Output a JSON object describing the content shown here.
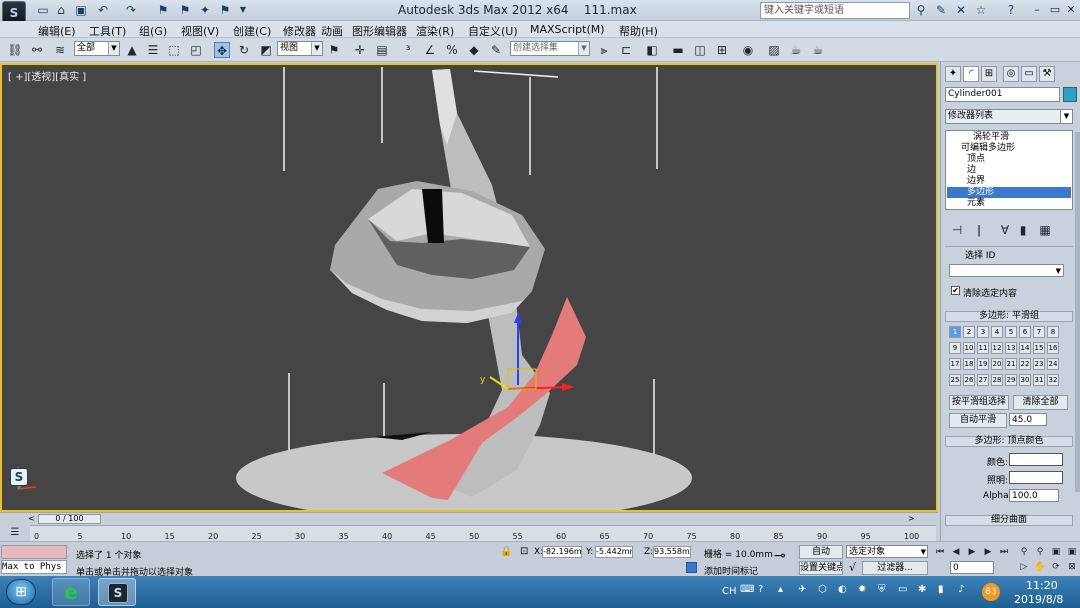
{
  "titlebar": {
    "app": "Autodesk 3ds Max  2012 x64",
    "file": "111.max",
    "search_placeholder": "键入关键字或短语"
  },
  "menu": [
    "编辑(E)",
    "工具(T)",
    "组(G)",
    "视图(V)",
    "创建(C)",
    "修改器",
    "动画",
    "图形编辑器",
    "渲染(R)",
    "自定义(U)",
    "MAXScript(M)",
    "帮助(H)"
  ],
  "toolbar": {
    "filter_value": "全部",
    "refcoord_value": "视图",
    "selection_set_value": "创建选择集"
  },
  "viewport": {
    "label": "[ +][透视][真实 ]"
  },
  "command_panel": {
    "object_name": "Cylinder001",
    "object_color": "#2aa3c8",
    "modifier_list": "修改器列表",
    "stack": [
      "涡轮平滑",
      "可编辑多边形",
      "顶点",
      "边",
      "边界",
      "多边形",
      "元素"
    ],
    "selected_stack_item": "多边形",
    "select_id_label": "选择 ID",
    "clear_selection_label": "清除选定内容",
    "smoothing_title": "多边形: 平滑组",
    "smoothing_groups": [
      "1",
      "2",
      "3",
      "4",
      "5",
      "6",
      "7",
      "8",
      "9",
      "10",
      "11",
      "12",
      "13",
      "14",
      "15",
      "16",
      "17",
      "18",
      "19",
      "20",
      "21",
      "22",
      "23",
      "24",
      "25",
      "26",
      "27",
      "28",
      "29",
      "30",
      "31",
      "32"
    ],
    "active_group": "1",
    "select_by_sg": "按平滑组选择",
    "clear_all": "清除全部",
    "auto_smooth": "自动平滑",
    "auto_smooth_value": "45.0",
    "vertex_color_title": "多边形: 顶点颜色",
    "color_label": "颜色:",
    "illum_label": "照明:",
    "alpha_label": "Alpha:",
    "alpha_value": "100.0",
    "subdivide_title": "细分曲面"
  },
  "timeline": {
    "slider": "0 / 100",
    "ticks": [
      "0",
      "5",
      "10",
      "15",
      "20",
      "25",
      "30",
      "35",
      "40",
      "45",
      "50",
      "55",
      "60",
      "65",
      "70",
      "75",
      "80",
      "85",
      "90",
      "95",
      "100"
    ]
  },
  "status": {
    "script_listener": "Max to Phys",
    "selected_msg": "选择了 1 个对象",
    "prompt_msg": "单击或单击并拖动以选择对象",
    "x_label": "X:",
    "x_value": "-82.196mm",
    "y_label": "Y:",
    "y_value": "-5.442mm",
    "z_label": "Z:",
    "z_value": "93.558mm",
    "grid": "栅格 = 10.0mm",
    "add_time_tag": "添加时间标记",
    "auto_key": "自动",
    "set_key": "设置关键点",
    "key_filter_combo": "选定对象",
    "filters": "过滤器...",
    "frame_value": "0"
  },
  "taskbar": {
    "lang": "CH",
    "badge": "83",
    "time": "11:20",
    "date": "2019/8/8"
  }
}
